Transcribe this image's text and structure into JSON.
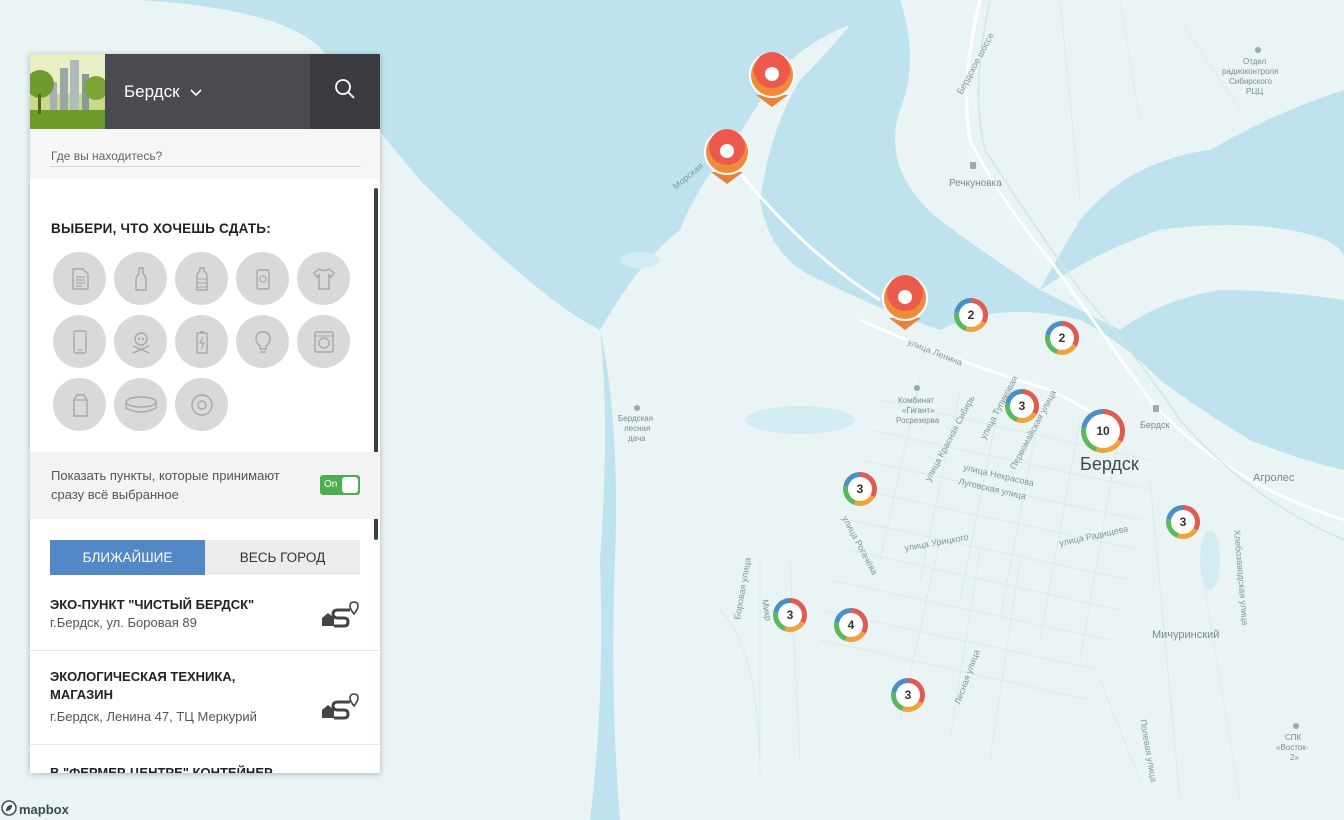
{
  "header": {
    "city": "Бердск"
  },
  "location": {
    "placeholder": "Где вы находитесь?"
  },
  "categories": {
    "title": "ВЫБЕРИ, ЧТО ХОЧЕШЬ СДАТЬ:",
    "items": [
      {
        "icon": "paper-icon"
      },
      {
        "icon": "glass-bottle-icon"
      },
      {
        "icon": "plastic-bottle-icon"
      },
      {
        "icon": "tin-can-icon"
      },
      {
        "icon": "clothes-icon"
      },
      {
        "icon": "phone-icon"
      },
      {
        "icon": "hazardous-icon"
      },
      {
        "icon": "battery-icon"
      },
      {
        "icon": "lightbulb-icon"
      },
      {
        "icon": "appliance-icon"
      },
      {
        "icon": "tetrapak-icon"
      },
      {
        "icon": "lid-icon"
      },
      {
        "icon": "tire-icon"
      }
    ]
  },
  "filter": {
    "text": "Показать пункты, которые принимают сразу всё выбранное",
    "toggle_label": "On",
    "enabled": true
  },
  "tabs": {
    "nearest": "БЛИЖАЙШИЕ",
    "city": "ВЕСЬ ГОРОД",
    "active": "nearest"
  },
  "places": [
    {
      "name": "ЭКО-ПУНКТ \"ЧИСТЫЙ БЕРДСК\"",
      "address": "г.Бердск, ул. Боровая 89"
    },
    {
      "name": "ЭКОЛОГИЧЕСКАЯ ТЕХНИКА, МАГАЗИН",
      "address": "г.Бердск, Ленина 47, ТЦ Меркурий"
    },
    {
      "name": "В \"ФЕРМЕР-ЦЕНТРЕ\" КОНТЕЙНЕР",
      "address": ""
    }
  ],
  "map": {
    "labels": {
      "city": "Бердск",
      "rechkunovka": "Речкуновка",
      "agroles": "Агролес",
      "michurinsky": "Мичуринский",
      "berdsk_station": "Бердск",
      "kombinat_1": "Комбинат",
      "kombinat_2": "«Гигант»",
      "kombinat_3": "Росрезерва",
      "dacha_1": "Бердская",
      "dacha_2": "лесная",
      "dacha_3": "дача",
      "otdel_1": "Отдел",
      "otdel_2": "радиоконтроля",
      "otdel_3": "Сибирского",
      "otdel_4": "РЦЦ",
      "spk_1": "СПК",
      "spk_2": "«Восток-",
      "spk_3": "2»",
      "street_lenina": "улица Ленина",
      "street_krasnaya": "улица Красная Сибирь",
      "street_pervomayskaya": "Первомайская улица",
      "street_nekrasova": "улица Некрасова",
      "street_lugovskogo": "Луговская улица",
      "street_rogachyova": "улица Рогачёва",
      "street_urickogo": "улица Урицкого",
      "street_radisheva": "улица Радищева",
      "street_khlebozavodskaya": "Хлебозаводская улица",
      "street_borovaya": "Боровая улица",
      "street_lesnaya": "Лесная улица",
      "street_polevaya": "Полевая улица",
      "street_morskaya": "Морская",
      "street_berdskoe": "Бердское шоссе",
      "street_tupikovaya": "улица Тупиковая",
      "street_mikr": "Микр"
    },
    "clusters": [
      {
        "id": "c1",
        "count": "2"
      },
      {
        "id": "c2",
        "count": "2"
      },
      {
        "id": "c3",
        "count": "3"
      },
      {
        "id": "c4",
        "count": "10"
      },
      {
        "id": "c5",
        "count": "3"
      },
      {
        "id": "c6",
        "count": "3"
      },
      {
        "id": "c7",
        "count": "3"
      },
      {
        "id": "c8",
        "count": "4"
      },
      {
        "id": "c9",
        "count": "3"
      }
    ],
    "attribution": "mapbox"
  }
}
